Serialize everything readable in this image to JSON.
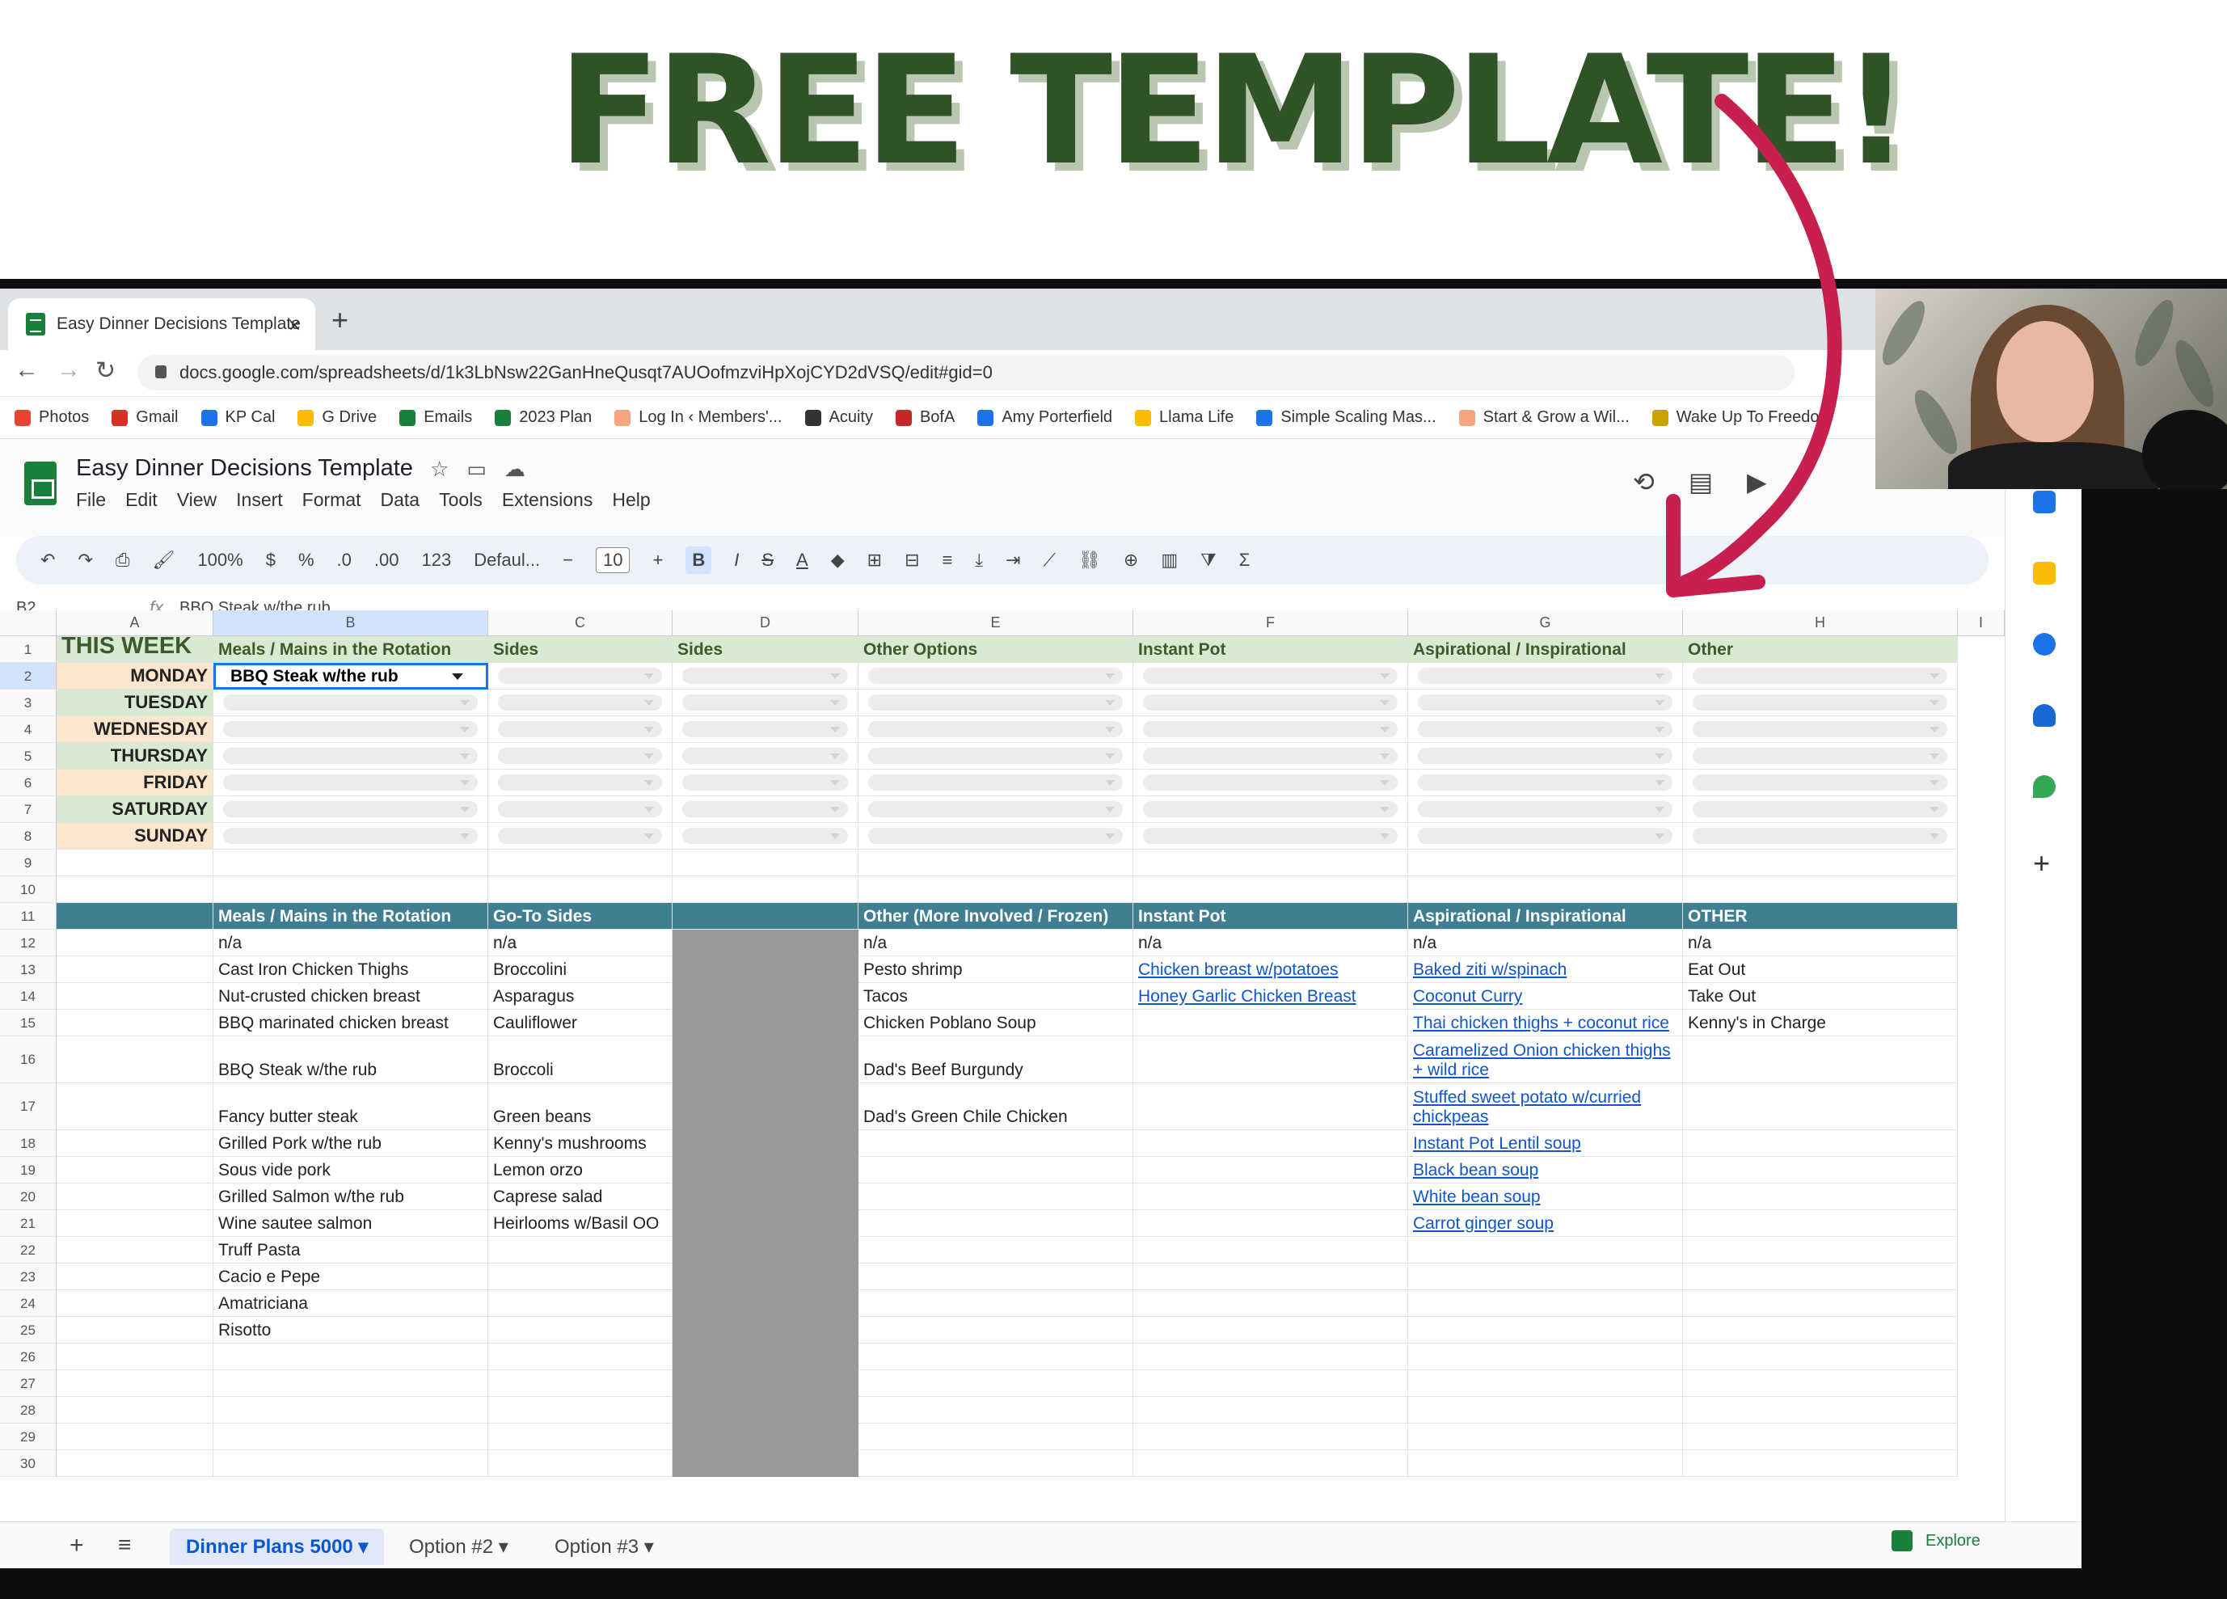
{
  "banner": {
    "title": "FREE TEMPLATE!"
  },
  "browser": {
    "tab_title": "Easy Dinner Decisions Template",
    "url": "docs.google.com/spreadsheets/d/1k3LbNsw22GanHneQusqt7AUOofmzviHpXojCYD2dVSQ/edit#gid=0",
    "bookmarks": [
      {
        "label": "Photos",
        "color": "#ea4335"
      },
      {
        "label": "Gmail",
        "color": "#d93025"
      },
      {
        "label": "KP Cal",
        "color": "#1a73e8"
      },
      {
        "label": "G Drive",
        "color": "#fbbc04"
      },
      {
        "label": "Emails",
        "color": "#188038"
      },
      {
        "label": "2023 Plan",
        "color": "#188038"
      },
      {
        "label": "Log In ‹ Members'...",
        "color": "#f4a582"
      },
      {
        "label": "Acuity",
        "color": "#333333"
      },
      {
        "label": "BofA",
        "color": "#c62828"
      },
      {
        "label": "Amy Porterfield",
        "color": "#1a73e8"
      },
      {
        "label": "Llama Life",
        "color": "#fbbc04"
      },
      {
        "label": "Simple Scaling Mas...",
        "color": "#1a73e8"
      },
      {
        "label": "Start & Grow a Wil...",
        "color": "#f4a582"
      },
      {
        "label": "Wake Up To Freedom",
        "color": "#c9a400"
      }
    ]
  },
  "sheets": {
    "doc_title": "Easy Dinner Decisions Template",
    "menu": [
      "File",
      "Edit",
      "View",
      "Insert",
      "Format",
      "Data",
      "Tools",
      "Extensions",
      "Help"
    ],
    "toolbar": {
      "zoom": "100%",
      "currency": "$",
      "percent": "%",
      "dec_minus": ".0",
      "dec_plus": ".00",
      "num": "123",
      "font": "Defaul...",
      "font_size": "10",
      "bold": "B",
      "italic": "I",
      "strike": "S",
      "text_color": "A",
      "sigma": "Σ"
    },
    "name_box": "B2",
    "formula": "BBQ Steak w/the rub",
    "columns": [
      "A",
      "B",
      "C",
      "D",
      "E",
      "F",
      "G",
      "H",
      "I"
    ],
    "header_row": {
      "a": "THIS WEEK",
      "b": "Meals / Mains in the Rotation",
      "c": "Sides",
      "d": "Sides",
      "e": "Other Options",
      "f": "Instant Pot",
      "g": "Aspirational / Inspirational",
      "h": "Other"
    },
    "days": [
      "MONDAY",
      "TUESDAY",
      "WEDNESDAY",
      "THURSDAY",
      "FRIDAY",
      "SATURDAY",
      "SUNDAY"
    ],
    "selected_value": "BBQ Steak w/the rub",
    "lists_header": {
      "b": "Meals / Mains in the Rotation",
      "c": "Go-To Sides",
      "e": "Other (More Involved / Frozen)",
      "f": "Instant Pot",
      "g": "Aspirational / Inspirational",
      "h": "OTHER"
    },
    "mains": [
      "n/a",
      "Cast Iron Chicken Thighs",
      "Nut-crusted chicken breast",
      "BBQ marinated chicken breast",
      "BBQ Steak w/the rub",
      "Fancy butter steak",
      "Grilled Pork w/the rub",
      "Sous vide pork",
      "Grilled Salmon w/the rub",
      "Wine sautee salmon",
      "Truff Pasta",
      "Cacio e Pepe",
      "Amatriciana",
      "Risotto"
    ],
    "sides": [
      "n/a",
      "Broccolini",
      "Asparagus",
      "Cauliflower",
      "Broccoli",
      "Green beans",
      "Kenny's mushrooms",
      "Lemon orzo",
      "Caprese salad",
      "Heirlooms w/Basil OO"
    ],
    "other_options": [
      "n/a",
      "Pesto shrimp",
      "Tacos",
      "Chicken Poblano Soup",
      "Dad's Beef Burgundy",
      "Dad's Green Chile Chicken"
    ],
    "instant_pot": [
      "n/a",
      "Chicken breast w/potatoes",
      "Honey Garlic Chicken Breast"
    ],
    "aspirational": [
      "n/a",
      "Baked ziti w/spinach",
      "Coconut Curry",
      "Thai chicken thighs + coconut rice",
      "Caramelized Onion chicken thighs + wild rice",
      "Stuffed sweet potato w/curried chickpeas",
      "Instant Pot Lentil soup",
      "Black bean soup",
      "White bean soup",
      "Carrot ginger soup"
    ],
    "other": [
      "n/a",
      "Eat Out",
      "Take Out",
      "Kenny's in Charge"
    ],
    "sheet_tabs": [
      "Dinner Plans 5000",
      "Option #2",
      "Option #3"
    ],
    "explore_label": "Explore"
  },
  "colors": {
    "banner_green": "#2f5227",
    "arrow": "#c8204e",
    "header_green": "#d9ead3",
    "teal_header": "#3f7f91",
    "peach": "#fce5cd"
  }
}
